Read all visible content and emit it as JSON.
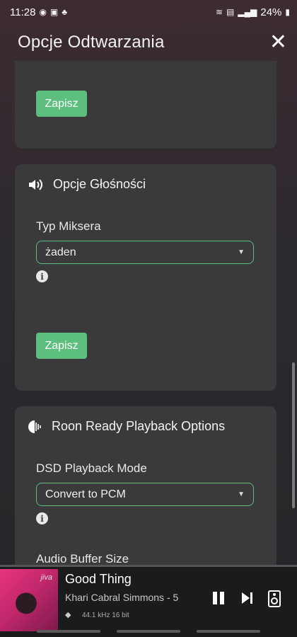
{
  "status_bar": {
    "time": "11:28",
    "battery": "24%"
  },
  "header": {
    "title": "Opcje Odtwarzania",
    "close_icon": "close-icon"
  },
  "cards": {
    "top": {
      "save_label": "Zapisz"
    },
    "volume": {
      "icon": "speaker-icon",
      "title": "Opcje Głośności",
      "mixer_label": "Typ Miksera",
      "mixer_value": "żaden",
      "save_label": "Zapisz"
    },
    "roon_ready": {
      "icon": "roon-ready-icon",
      "title": "Roon Ready Playback Options",
      "dsd_label": "DSD Playback Mode",
      "dsd_value": "Convert to PCM",
      "buffer_label": "Audio Buffer Size"
    }
  },
  "player": {
    "album_text": "jiva",
    "title": "Good Thing",
    "artist": "Khari Cabral Simmons - 5",
    "format": "44.1 kHz 16 bit"
  },
  "colors": {
    "accent": "#5cbf7d",
    "card": "#3a393c"
  }
}
